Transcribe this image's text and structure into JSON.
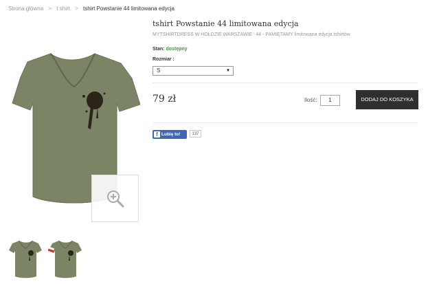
{
  "breadcrumb": {
    "home": "Strona główna",
    "category": "t shirt",
    "current": "tshirt Powstanie 44 limitowana edycja",
    "separator": ">"
  },
  "product": {
    "title": "tshirt Powstanie 44 limitowana edycja",
    "subtitle": "MYTSHIRTDRESS W HOŁDZIE WARSZAWIE ' 44 - PAMIĘTAMY limitowana edycja tshirtów",
    "stock_label": "Stan:",
    "stock_value": "dostępny",
    "size_label": "Rozmiar :",
    "size_selected": "S",
    "price": "79 zł",
    "qty_label": "Ilość:",
    "qty_value": "1",
    "add_to_cart": "DODAJ DO KOSZYKA"
  },
  "social": {
    "like_label": "Lubię to!",
    "like_count": "137"
  },
  "colors": {
    "shirt": "#7c8466",
    "stain": "#2a2419",
    "button": "#2f2f2f",
    "in_stock": "#3a9d3a",
    "facebook": "#4267b2"
  }
}
